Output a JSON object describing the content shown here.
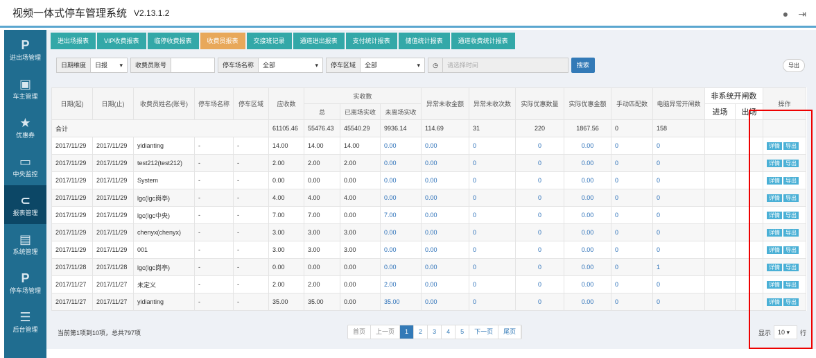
{
  "header": {
    "title": "视频一体式停车管理系统",
    "version": "V2.13.1.2"
  },
  "sidebar": [
    {
      "icon": "P",
      "label": "进出场管理"
    },
    {
      "icon": "▣",
      "label": "车主管理"
    },
    {
      "icon": "★",
      "label": "优惠券"
    },
    {
      "icon": "▭",
      "label": "中央监控"
    },
    {
      "icon": "⊂",
      "label": "报表管理"
    },
    {
      "icon": "▤",
      "label": "系统管理"
    },
    {
      "icon": "P",
      "label": "停车场管理"
    },
    {
      "icon": "☰",
      "label": "后台管理"
    }
  ],
  "tabs": [
    "进出场报表",
    "VIP收费报表",
    "临停收费报表",
    "收费员报表",
    "交接班记录",
    "通道进出报表",
    "支付统计报表",
    "储值统计报表",
    "通道收费统计报表"
  ],
  "filters": {
    "date_dim_label": "日期维度",
    "date_dim_value": "日报",
    "account_label": "收费员账号",
    "park_label": "停车场名称",
    "park_value": "全部",
    "area_label": "停车区域",
    "area_value": "全部",
    "time_placeholder": "请选择时间",
    "search": "搜索",
    "export": "导出"
  },
  "table": {
    "headers": {
      "start": "日期(起)",
      "end": "日期(止)",
      "name": "收费员姓名(账号)",
      "park": "停车场名称",
      "area": "停车区域",
      "due": "应收数",
      "received": "实收数",
      "total": "总",
      "left": "已离场实收",
      "notleft": "未离场实收",
      "abn_amt": "异常未收金额",
      "abn_cnt": "异常未收次数",
      "disc_cnt": "实际优惠数量",
      "disc_amt": "实际优惠金额",
      "manual": "手动匹配数",
      "pc_open": "电脑异常开闸数",
      "nonsys": "非系统开闸数",
      "in": "进场",
      "out": "出场",
      "op": "操作"
    },
    "total_row": {
      "label": "合计",
      "due": "61105.46",
      "total": "55476.43",
      "left": "45540.29",
      "notleft": "9936.14",
      "abn_amt": "114.69",
      "abn_cnt": "31",
      "disc_cnt": "220",
      "disc_amt": "1867.56",
      "manual": "0",
      "pc_open": "158"
    },
    "rows": [
      [
        "2017/11/29",
        "2017/11/29",
        "yidianting",
        "-",
        "-",
        "14.00",
        "14.00",
        "14.00",
        "0.00",
        "0.00",
        "0",
        "0",
        "0.00",
        "0",
        "0"
      ],
      [
        "2017/11/29",
        "2017/11/29",
        "test212(test212)",
        "-",
        "-",
        "2.00",
        "2.00",
        "2.00",
        "0.00",
        "0.00",
        "0",
        "0",
        "0.00",
        "0",
        "0"
      ],
      [
        "2017/11/29",
        "2017/11/29",
        "System",
        "-",
        "-",
        "0.00",
        "0.00",
        "0.00",
        "0.00",
        "0.00",
        "0",
        "0",
        "0.00",
        "0",
        "0"
      ],
      [
        "2017/11/29",
        "2017/11/29",
        "lgc(lgc岗亭)",
        "-",
        "-",
        "4.00",
        "4.00",
        "4.00",
        "0.00",
        "0.00",
        "0",
        "0",
        "0.00",
        "0",
        "0"
      ],
      [
        "2017/11/29",
        "2017/11/29",
        "lgc(lgc中央)",
        "-",
        "-",
        "7.00",
        "7.00",
        "0.00",
        "7.00",
        "0.00",
        "0",
        "0",
        "0.00",
        "0",
        "0"
      ],
      [
        "2017/11/29",
        "2017/11/29",
        "chenyx(chenyx)",
        "-",
        "-",
        "3.00",
        "3.00",
        "3.00",
        "0.00",
        "0.00",
        "0",
        "0",
        "0.00",
        "0",
        "0"
      ],
      [
        "2017/11/29",
        "2017/11/29",
        "001",
        "-",
        "-",
        "3.00",
        "3.00",
        "3.00",
        "0.00",
        "0.00",
        "0",
        "0",
        "0.00",
        "0",
        "0"
      ],
      [
        "2017/11/28",
        "2017/11/28",
        "lgc(lgc岗亭)",
        "-",
        "-",
        "0.00",
        "0.00",
        "0.00",
        "0.00",
        "0.00",
        "0",
        "0",
        "0.00",
        "0",
        "1"
      ],
      [
        "2017/11/27",
        "2017/11/27",
        "未定义",
        "-",
        "-",
        "2.00",
        "2.00",
        "0.00",
        "2.00",
        "0.00",
        "0",
        "0",
        "0.00",
        "0",
        "0"
      ],
      [
        "2017/11/27",
        "2017/11/27",
        "yidianting",
        "-",
        "-",
        "35.00",
        "35.00",
        "0.00",
        "35.00",
        "0.00",
        "0",
        "0",
        "0.00",
        "0",
        "0"
      ]
    ],
    "ops": {
      "detail": "详情",
      "export": "导出"
    }
  },
  "footer": {
    "info": "当前第1项到10项，总共797项",
    "pages": [
      "首页",
      "上一页",
      "1",
      "2",
      "3",
      "4",
      "5",
      "下一页",
      "尾页"
    ],
    "current_page": "1",
    "show": "显示",
    "page_size": "10",
    "rows": "行"
  }
}
